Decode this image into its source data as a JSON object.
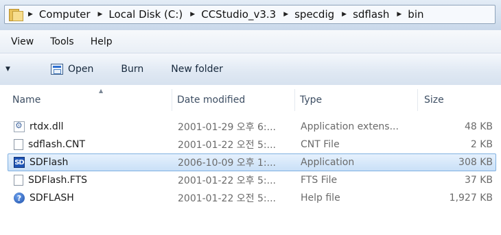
{
  "address_bar": {
    "crumbs": [
      "Computer",
      "Local Disk (C:)",
      "CCStudio_v3.3",
      "specdig",
      "sdflash",
      "bin"
    ]
  },
  "menu": {
    "items": [
      "View",
      "Tools",
      "Help"
    ]
  },
  "toolbar": {
    "open_label": "Open",
    "burn_label": "Burn",
    "new_folder_label": "New folder"
  },
  "columns": {
    "name": "Name",
    "date_modified": "Date modified",
    "type": "Type",
    "size": "Size"
  },
  "files": [
    {
      "name": "rtdx.dll",
      "date": "2001-01-29 오후 6:...",
      "type": "Application extens...",
      "size": "48 KB",
      "icon": "dll-icon"
    },
    {
      "name": "sdflash.CNT",
      "date": "2001-01-22 오전 5:...",
      "type": "CNT File",
      "size": "2 KB",
      "icon": "document-icon"
    },
    {
      "name": "SDFlash",
      "date": "2006-10-09 오후 1:...",
      "type": "Application",
      "size": "308 KB",
      "icon": "application-icon",
      "selected": true
    },
    {
      "name": "SDFlash.FTS",
      "date": "2001-01-22 오후 5:...",
      "type": "FTS File",
      "size": "37 KB",
      "icon": "document-icon"
    },
    {
      "name": "SDFLASH",
      "date": "2001-01-22 오전 5:...",
      "type": "Help file",
      "size": "1,927 KB",
      "icon": "help-icon"
    }
  ],
  "colors": {
    "selection_fill": "#cce3f8",
    "selection_border": "#7fb0e1"
  }
}
